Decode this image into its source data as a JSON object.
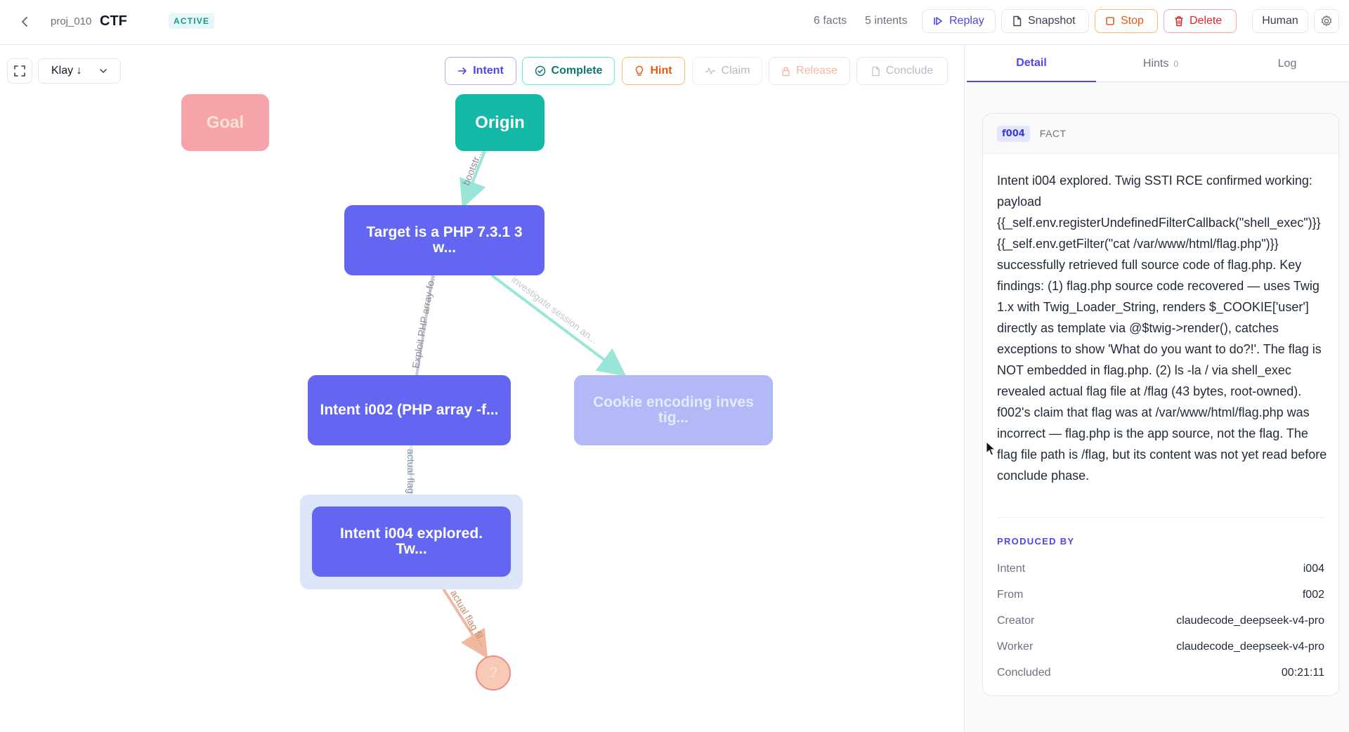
{
  "header": {
    "project_id": "proj_010",
    "project_name": "CTF",
    "status": "ACTIVE",
    "facts_count": "6 facts",
    "intents_count": "5 intents",
    "buttons": {
      "replay": "Replay",
      "snapshot": "Snapshot",
      "stop": "Stop",
      "delete": "Delete",
      "human": "Human"
    }
  },
  "canvas": {
    "layout_select": "Klay ↓",
    "actions": {
      "intent": "Intent",
      "complete": "Complete",
      "hint": "Hint",
      "claim": "Claim",
      "release": "Release",
      "conclude": "Conclude"
    },
    "nodes": {
      "goal": "Goal",
      "origin": "Origin",
      "target": "Target is a PHP 7.3.1 3 w...",
      "i002": "Intent i002 (PHP array -f...",
      "cookie": "Cookie encoding inves tig...",
      "i004": "Intent i004 explored. Tw...",
      "unknown": "?"
    },
    "edges": {
      "bootstrap": "bootstr...",
      "exploit": "Exploit PHP array-fo...",
      "investigate": "investigate session an...",
      "actual_flag": "actual flag fi...",
      "the_actual_flag": "the actual flag fil..."
    },
    "colors": {
      "intent_node": "#6366f1",
      "origin_node": "#14b8a6",
      "goal_node": "#f6a3aa",
      "teal_edge": "#99e6d8",
      "gray_edge": "#c0c4cc",
      "orange_edge": "#f0b8a0"
    }
  },
  "panel": {
    "tabs": {
      "detail": "Detail",
      "hints": "Hints",
      "hints_count": "0",
      "log": "Log"
    },
    "fact": {
      "id": "f004",
      "type": "FACT",
      "text": "Intent i004 explored. Twig SSTI RCE confirmed working: payload {{_self.env.registerUndefinedFilterCallback(\"shell_exec\")}}{{_self.env.getFilter(\"cat /var/www/html/flag.php\")}} successfully retrieved full source code of flag.php. Key findings: (1) flag.php source code recovered — uses Twig 1.x with Twig_Loader_String, renders $_COOKIE['user'] directly as template via @$twig->render(), catches exceptions to show 'What do you want to do?!'. The flag is NOT embedded in flag.php. (2) ls -la / via shell_exec revealed actual flag file at /flag (43 bytes, root-owned). f002's claim that flag was at /var/www/html/flag.php was incorrect — flag.php is the app source, not the flag. The flag file path is /flag, but its content was not yet read before conclude phase.",
      "produced_by_title": "PRODUCED BY",
      "produced_by": [
        {
          "key": "Intent",
          "value": "i004"
        },
        {
          "key": "From",
          "value": "f002"
        },
        {
          "key": "Creator",
          "value": "claudecode_deepseek-v4-pro"
        },
        {
          "key": "Worker",
          "value": "claudecode_deepseek-v4-pro"
        },
        {
          "key": "Concluded",
          "value": "00:21:11"
        }
      ]
    }
  }
}
